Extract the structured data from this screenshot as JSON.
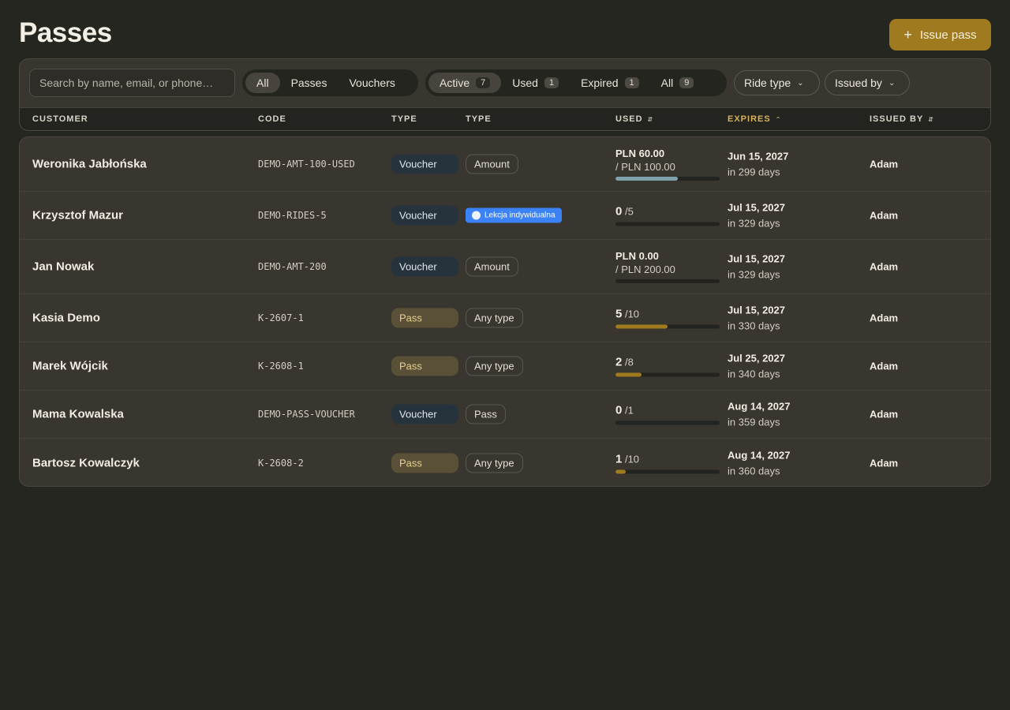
{
  "page": {
    "title": "Passes",
    "issue_button": "Issue pass"
  },
  "search": {
    "placeholder": "Search by name, email, or phone…"
  },
  "kind_filter": {
    "items": [
      {
        "label": "All",
        "active": true
      },
      {
        "label": "Passes",
        "active": false
      },
      {
        "label": "Vouchers",
        "active": false
      }
    ]
  },
  "status_filter": {
    "items": [
      {
        "label": "Active",
        "count": "7",
        "active": true
      },
      {
        "label": "Used",
        "count": "1",
        "active": false
      },
      {
        "label": "Expired",
        "count": "1",
        "active": false
      },
      {
        "label": "All",
        "count": "9",
        "active": false
      }
    ]
  },
  "dropdowns": {
    "ride_type": "Ride type",
    "issued_by": "Issued by"
  },
  "columns": {
    "customer": "CUSTOMER",
    "code": "CODE",
    "type": "TYPE",
    "subtype": "TYPE",
    "used": "USED",
    "expires": "EXPIRES",
    "issued_by": "ISSUED BY"
  },
  "colors": {
    "accent": "#a07a1f",
    "voucher_badge": "#26323c",
    "pass_badge": "#5a5038",
    "lesson_badge": "#3b82f6",
    "amount_bar": "#7fa3ad"
  },
  "rows": [
    {
      "customer": "Weronika Jabłońska",
      "code": "DEMO-AMT-100-USED",
      "kind": "Voucher",
      "subtype": "Amount",
      "subtype_style": "outline",
      "used_mode": "amount",
      "used_value": "PLN 60.00",
      "used_total": "/ PLN 100.00",
      "progress": 0.6,
      "expires": "Jun 15, 2027",
      "expires_in": "in 299 days",
      "issued_by": "Adam"
    },
    {
      "customer": "Krzysztof Mazur",
      "code": "DEMO-RIDES-5",
      "kind": "Voucher",
      "subtype": "Lekcja indywidualna",
      "subtype_style": "lesson",
      "used_mode": "count",
      "used_value": "0",
      "used_total": "/5",
      "progress": 0,
      "expires": "Jul 15, 2027",
      "expires_in": "in 329 days",
      "issued_by": "Adam"
    },
    {
      "customer": "Jan Nowak",
      "code": "DEMO-AMT-200",
      "kind": "Voucher",
      "subtype": "Amount",
      "subtype_style": "outline",
      "used_mode": "amount",
      "used_value": "PLN 0.00",
      "used_total": "/ PLN 200.00",
      "progress": 0,
      "expires": "Jul 15, 2027",
      "expires_in": "in 329 days",
      "issued_by": "Adam"
    },
    {
      "customer": "Kasia Demo",
      "code": "K-2607-1",
      "kind": "Pass",
      "subtype": "Any type",
      "subtype_style": "outline",
      "used_mode": "count",
      "used_value": "5",
      "used_total": "/10",
      "progress": 0.5,
      "expires": "Jul 15, 2027",
      "expires_in": "in 330 days",
      "issued_by": "Adam"
    },
    {
      "customer": "Marek Wójcik",
      "code": "K-2608-1",
      "kind": "Pass",
      "subtype": "Any type",
      "subtype_style": "outline",
      "used_mode": "count",
      "used_value": "2",
      "used_total": "/8",
      "progress": 0.25,
      "expires": "Jul 25, 2027",
      "expires_in": "in 340 days",
      "issued_by": "Adam"
    },
    {
      "customer": "Mama Kowalska",
      "code": "DEMO-PASS-VOUCHER",
      "kind": "Voucher",
      "subtype": "Pass",
      "subtype_style": "outline",
      "used_mode": "count",
      "used_value": "0",
      "used_total": "/1",
      "progress": 0,
      "expires": "Aug 14, 2027",
      "expires_in": "in 359 days",
      "issued_by": "Adam"
    },
    {
      "customer": "Bartosz Kowalczyk",
      "code": "K-2608-2",
      "kind": "Pass",
      "subtype": "Any type",
      "subtype_style": "outline",
      "used_mode": "count",
      "used_value": "1",
      "used_total": "/10",
      "progress": 0.1,
      "expires": "Aug 14, 2027",
      "expires_in": "in 360 days",
      "issued_by": "Adam"
    }
  ]
}
